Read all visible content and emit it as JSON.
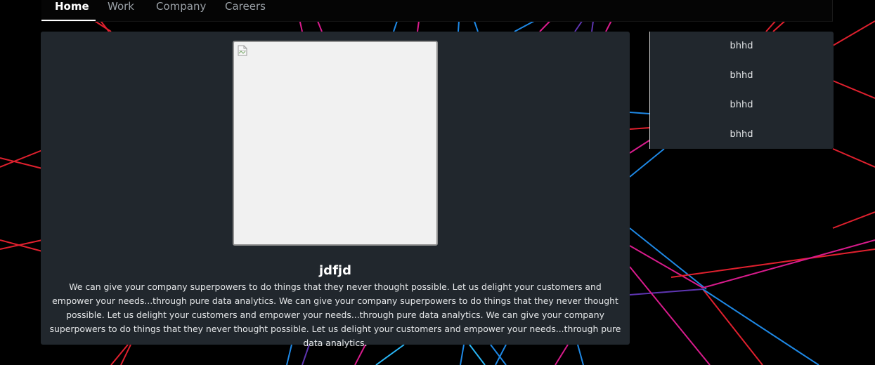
{
  "nav": {
    "items": [
      {
        "label": "Home",
        "active": true
      },
      {
        "label": "Work",
        "active": false
      },
      {
        "label": "Company",
        "active": false
      },
      {
        "label": "Careers",
        "active": false
      }
    ]
  },
  "card": {
    "image_icon": "broken-image-icon",
    "title": "jdfjd",
    "body": "We can give your company superpowers to do things that they never thought possible. Let us delight your customers and empower your needs...through pure data analytics. We can give your company superpowers to do things that they never thought possible. Let us delight your customers and empower your needs...through pure data analytics. We can give your company superpowers to do things that they never thought possible. Let us delight your customers and empower your needs...through pure data analytics."
  },
  "side_menu": {
    "items": [
      {
        "label": "bhhd"
      },
      {
        "label": "bhhd"
      },
      {
        "label": "bhhd"
      },
      {
        "label": "bhhd"
      }
    ]
  },
  "colors": {
    "background": "#000000",
    "panel": "#21272d",
    "line_red": "#e0202e",
    "line_blue": "#1e88e5",
    "line_magenta": "#d81b8c",
    "line_purple": "#5e35b1"
  }
}
